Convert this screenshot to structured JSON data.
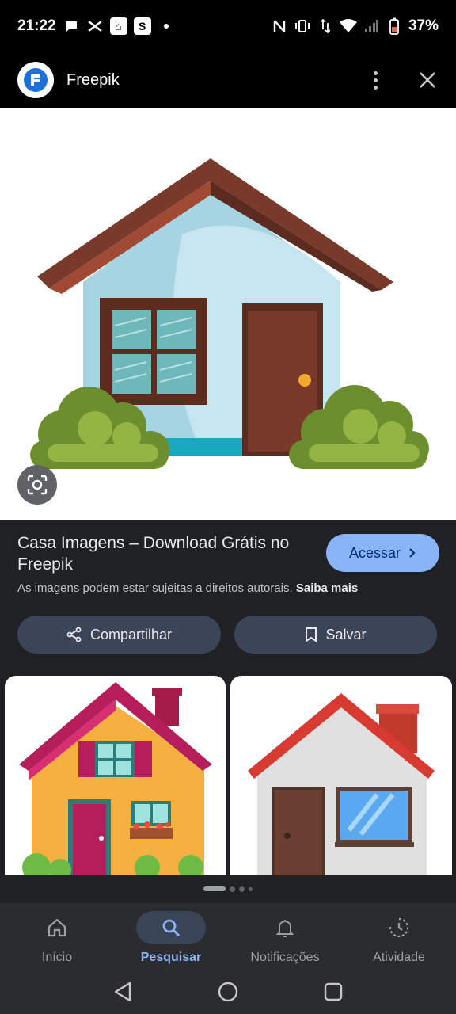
{
  "status_bar": {
    "time": "21:22",
    "battery": "37%",
    "notification_icons": [
      "chat-icon",
      "capcut-icon",
      "home-app-icon",
      "s-app-icon",
      "dot-icon"
    ],
    "s_app_letter": "S",
    "system_icons": [
      "nfc-icon",
      "vibrate-icon",
      "data-arrows-icon",
      "wifi-icon",
      "signal-icon",
      "battery-icon"
    ]
  },
  "app_header": {
    "title": "Freepik",
    "logo_color": "#1d6fe0"
  },
  "result": {
    "title": "Casa Imagens – Download Grátis no Freepik",
    "visit_label": "Acessar",
    "copyright_note": "As imagens podem estar sujeitas a direitos autorais.",
    "learn_more": "Saiba mais"
  },
  "actions": {
    "share_label": "Compartilhar",
    "save_label": "Salvar"
  },
  "pager": {
    "pages": 4,
    "active_index": 0
  },
  "bottom_nav": {
    "items": [
      {
        "label": "Início",
        "icon": "home-icon",
        "active": false
      },
      {
        "label": "Pesquisar",
        "icon": "search-icon",
        "active": true
      },
      {
        "label": "Notificações",
        "icon": "bell-icon",
        "active": false
      },
      {
        "label": "Atividade",
        "icon": "activity-icon",
        "active": false
      }
    ]
  },
  "colors": {
    "accent": "#8ab4f8",
    "background": "#202124",
    "pill_button": "#3c4458"
  }
}
